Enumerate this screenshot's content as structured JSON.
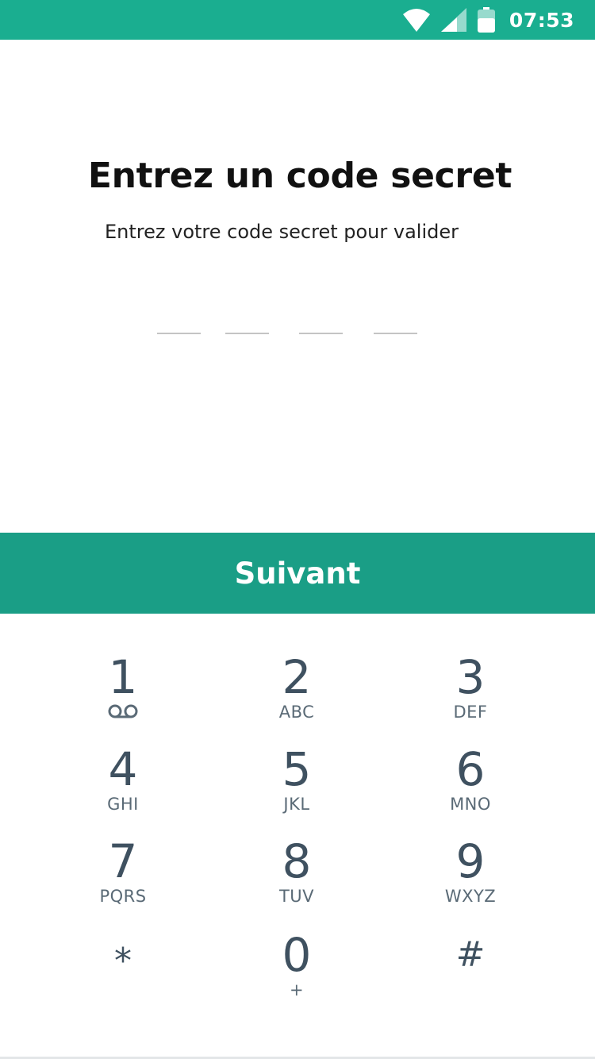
{
  "status_bar": {
    "time": "07:53",
    "icons": [
      "wifi-icon",
      "cell-signal-icon",
      "battery-icon"
    ],
    "color": "#1aae90"
  },
  "header": {
    "title": "Entrez un code secret",
    "subtitle": "Entrez votre code secret pour valider"
  },
  "pin": {
    "length": 4,
    "entered": 0
  },
  "next_button": {
    "label": "Suivant",
    "color": "#1a9e86"
  },
  "keypad": {
    "keys": [
      {
        "digit": "1",
        "sub": "",
        "sub_icon": "voicemail-icon"
      },
      {
        "digit": "2",
        "sub": "ABC"
      },
      {
        "digit": "3",
        "sub": "DEF"
      },
      {
        "digit": "4",
        "sub": "GHI"
      },
      {
        "digit": "5",
        "sub": "JKL"
      },
      {
        "digit": "6",
        "sub": "MNO"
      },
      {
        "digit": "7",
        "sub": "PQRS"
      },
      {
        "digit": "8",
        "sub": "TUV"
      },
      {
        "digit": "9",
        "sub": "WXYZ"
      },
      {
        "digit": "*",
        "sub": ""
      },
      {
        "digit": "0",
        "sub": "+"
      },
      {
        "digit": "#",
        "sub": ""
      }
    ]
  }
}
